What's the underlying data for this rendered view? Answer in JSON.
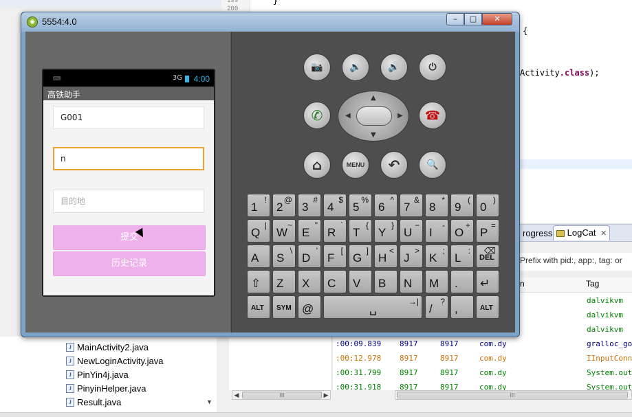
{
  "ide": {
    "line_numbers": [
      "199",
      "200"
    ],
    "code_fragments": [
      "}",
      "{",
      "Activity",
      ".class",
      ");"
    ],
    "tabs": [
      {
        "label": "rogress"
      },
      {
        "label": "LogCat",
        "close": "✕"
      }
    ],
    "filter_text": "Prefix with pid:, app:, tag: or",
    "columns": {
      "col1": "n",
      "tag": "Tag"
    },
    "log_rows": [
      {
        "time": "",
        "pid": "",
        "tid": "",
        "app": "",
        "tag": "dalvikvm",
        "color": "#008000"
      },
      {
        "time": "",
        "pid": "",
        "tid": "",
        "app": "",
        "tag": "dalvikvm",
        "color": "#008000"
      },
      {
        "time": "",
        "pid": "",
        "tid": "",
        "app": "",
        "tag": "dalvikvm",
        "color": "#008000"
      },
      {
        "time": ":00:09.839",
        "pid": "8917",
        "tid": "8917",
        "app": "com.dy",
        "tag": "gralloc_go",
        "color": "#000080"
      },
      {
        "time": ":00:12.978",
        "pid": "8917",
        "tid": "8917",
        "app": "com.dy",
        "tag": "IInputConn",
        "color": "#c87000"
      },
      {
        "time": ":00:31.799",
        "pid": "8917",
        "tid": "8917",
        "app": "com.dy",
        "tag": "System.out",
        "color": "#008000"
      },
      {
        "time": ":00:31.918",
        "pid": "8917",
        "tid": "8917",
        "app": "com.dy",
        "tag": "System.out",
        "color": "#008000"
      }
    ],
    "files": [
      "MainActivity2.java",
      "NewLoginActivity.java",
      "PinYin4j.java",
      "PinyinHelper.java",
      "Result.java"
    ],
    "scroll_thumb": "III"
  },
  "emulator": {
    "title": "5554:4.0",
    "window_buttons": {
      "min": "–",
      "max": "□",
      "close": "✕"
    },
    "phone": {
      "time": "4:00",
      "signal": "3G",
      "app_title": "高铁助手",
      "field1_value": "G001",
      "field2_value": "n",
      "field3_placeholder": "目的地",
      "submit_label": "提交",
      "history_label": "历史记录"
    },
    "controls": {
      "camera": "📷",
      "vol_down": "🔉",
      "vol_up": "🔊",
      "power": "⏻",
      "call": "✆",
      "end_call": "☎",
      "home": "⌂",
      "menu": "MENU",
      "back": "↶",
      "search": "🔍",
      "dpad_up": "▲",
      "dpad_down": "▼",
      "dpad_left": "◀",
      "dpad_right": "▶"
    },
    "keyboard": {
      "row1": [
        [
          "1",
          "!"
        ],
        [
          "2",
          "@"
        ],
        [
          "3",
          "#"
        ],
        [
          "4",
          "$"
        ],
        [
          "5",
          "%"
        ],
        [
          "6",
          "^"
        ],
        [
          "7",
          "&"
        ],
        [
          "8",
          "*"
        ],
        [
          "9",
          "("
        ],
        [
          "0",
          ")"
        ]
      ],
      "row2": [
        [
          "Q",
          "|"
        ],
        [
          "W",
          "~"
        ],
        [
          "E",
          "\""
        ],
        [
          "R",
          "`"
        ],
        [
          "T",
          "{"
        ],
        [
          "Y",
          "}"
        ],
        [
          "U",
          "−"
        ],
        [
          "I",
          "-"
        ],
        [
          "O",
          "+"
        ],
        [
          "P",
          "="
        ]
      ],
      "row3": [
        [
          "A",
          ""
        ],
        [
          "S",
          "\\"
        ],
        [
          "D",
          "'"
        ],
        [
          "F",
          "["
        ],
        [
          "G",
          "]"
        ],
        [
          "H",
          "<"
        ],
        [
          "J",
          ">"
        ],
        [
          "K",
          ";"
        ],
        [
          "L",
          ":"
        ],
        [
          "DEL",
          "⌫"
        ]
      ],
      "row4": [
        [
          "⇧",
          ""
        ],
        [
          "Z",
          ""
        ],
        [
          "X",
          ""
        ],
        [
          "C",
          ""
        ],
        [
          "V",
          ""
        ],
        [
          "B",
          ""
        ],
        [
          "N",
          ""
        ],
        [
          "M",
          ""
        ],
        [
          ".",
          ""
        ],
        [
          "↵",
          ""
        ]
      ],
      "row5": [
        [
          "ALT",
          ""
        ],
        [
          "SYM",
          ""
        ],
        [
          "@",
          ""
        ],
        [
          "␣",
          "→|"
        ],
        [
          "/",
          "?"
        ],
        [
          ",",
          ""
        ],
        [
          "ALT",
          ""
        ]
      ]
    }
  }
}
